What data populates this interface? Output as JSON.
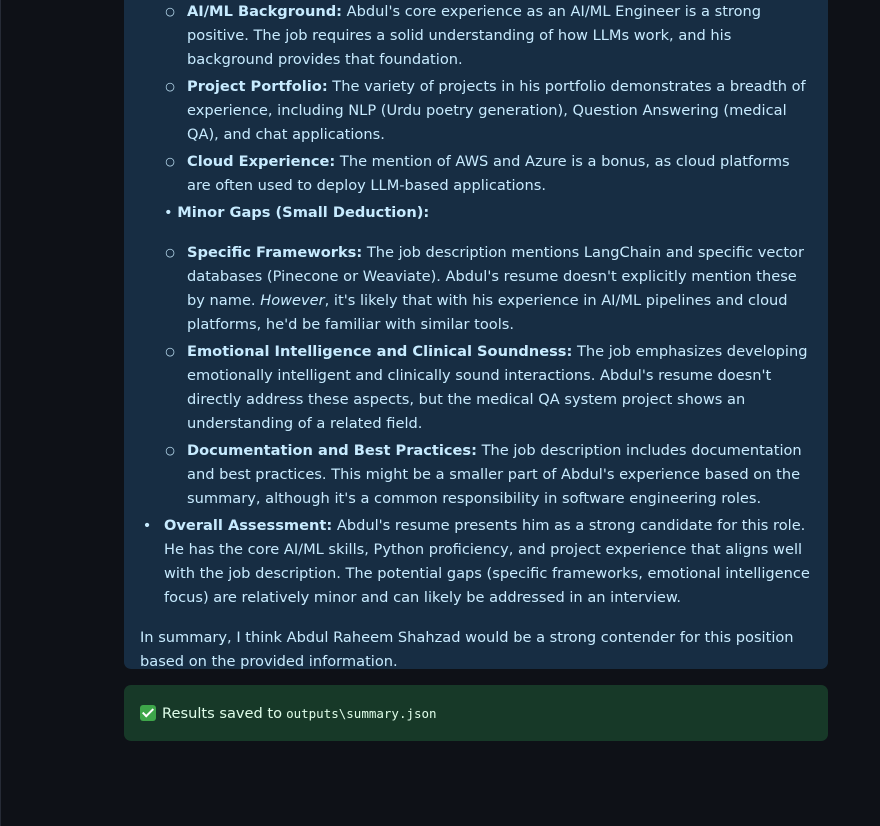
{
  "colors": {
    "background": "#0e1117",
    "info_card": "#172d43",
    "info_text": "#c7ebff",
    "success_card": "#173928",
    "success_text": "#dffde9",
    "check_green": "#3ea64a"
  },
  "strengths": {
    "items": [
      {
        "title": "AI/ML Background:",
        "text": " Abdul's core experience as an AI/ML Engineer is a strong positive. The job requires a solid understanding of how LLMs work, and his background provides that foundation."
      },
      {
        "title": "Project Portfolio:",
        "text": " The variety of projects in his portfolio demonstrates a breadth of experience, including NLP (Urdu poetry generation), Question Answering (medical QA), and chat applications."
      },
      {
        "title": "Cloud Experience:",
        "text": " The mention of AWS and Azure is a bonus, as cloud platforms are often used to deploy LLM-based applications."
      }
    ]
  },
  "gaps": {
    "heading": "Minor Gaps (Small Deduction):",
    "item1": {
      "title": "Specific Frameworks:",
      "text_a": " The job description mentions LangChain and specific vector databases (Pinecone or Weaviate). Abdul's resume doesn't explicitly mention these by name. ",
      "emph": "However",
      "text_b": ", it's likely that with his experience in AI/ML pipelines and cloud platforms, he'd be familiar with similar tools."
    },
    "item2": {
      "title": "Emotional Intelligence and Clinical Soundness:",
      "text": " The job emphasizes developing emotionally intelligent and clinically sound interactions. Abdul's resume doesn't directly address these aspects, but the medical QA system project shows an understanding of a related field."
    },
    "item3": {
      "title": "Documentation and Best Practices:",
      "text": " The job description includes documentation and best practices. This might be a smaller part of Abdul's experience based on the summary, although it's a common responsibility in software engineering roles."
    }
  },
  "overall": {
    "title": "Overall Assessment:",
    "text": " Abdul's resume presents him as a strong candidate for this role. He has the core AI/ML skills, Python proficiency, and project experience that aligns well with the job description. The potential gaps (specific frameworks, emotional intelligence focus) are relatively minor and can likely be addressed in an interview."
  },
  "summary": "In summary, I think Abdul Raheem Shahzad would be a strong contender for this position based on the provided information.",
  "success": {
    "icon": "check-mark-icon",
    "message": "Results saved to",
    "path": "outputs\\summary.json"
  }
}
